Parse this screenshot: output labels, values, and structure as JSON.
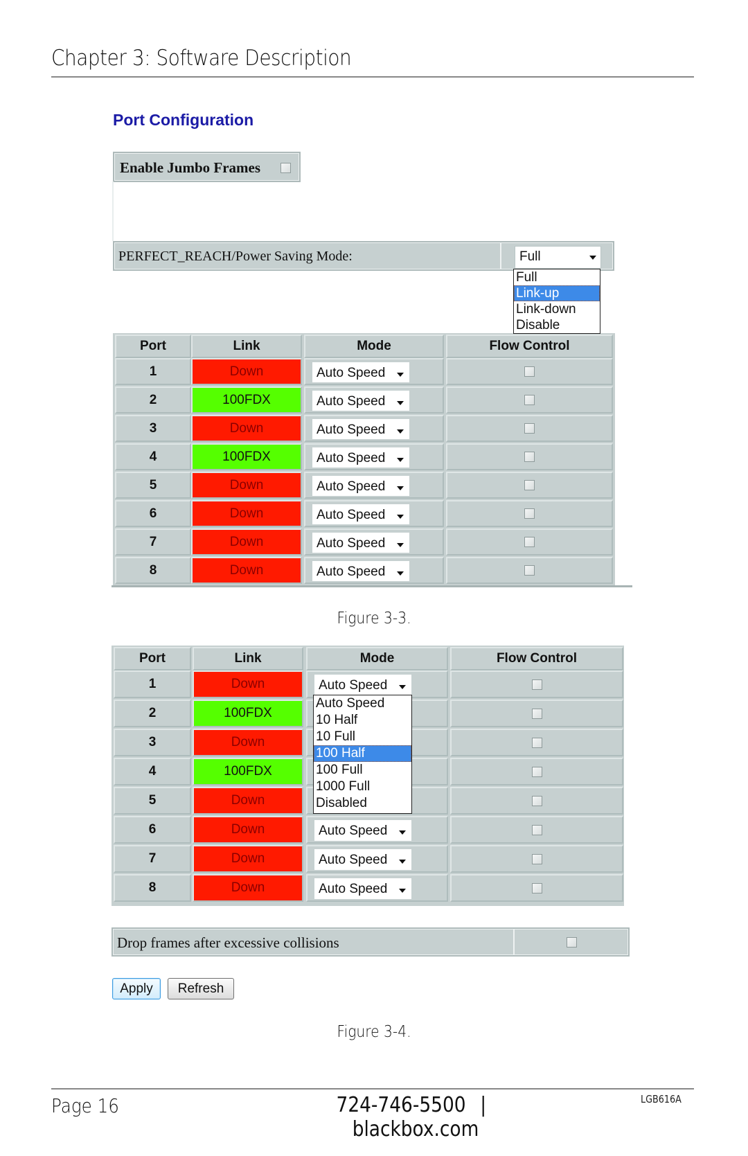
{
  "header": {
    "chapter_title": "Chapter 3: Software Description"
  },
  "port_configuration": {
    "title": "Port Configuration",
    "jumbo_frames": {
      "label": "Enable Jumbo Frames",
      "checked": false
    },
    "power_saving": {
      "label": "PERFECT_REACH/Power Saving Mode:",
      "selected": "Full",
      "options": [
        "Full",
        "Link-up",
        "Link-down",
        "Disable"
      ],
      "highlighted": "Link-up"
    }
  },
  "figure_3_3": {
    "caption": "Figure 3-3.",
    "columns": [
      "Port",
      "Link",
      "Mode",
      "Flow Control"
    ],
    "rows": [
      {
        "port": "1",
        "link": "Down",
        "link_state": "down",
        "mode": "Auto Speed",
        "flow_control": false
      },
      {
        "port": "2",
        "link": "100FDX",
        "link_state": "up",
        "mode": "Auto Speed",
        "flow_control": false
      },
      {
        "port": "3",
        "link": "Down",
        "link_state": "down",
        "mode": "Auto Speed",
        "flow_control": false
      },
      {
        "port": "4",
        "link": "100FDX",
        "link_state": "up",
        "mode": "Auto Speed",
        "flow_control": false
      },
      {
        "port": "5",
        "link": "Down",
        "link_state": "down",
        "mode": "Auto Speed",
        "flow_control": false
      },
      {
        "port": "6",
        "link": "Down",
        "link_state": "down",
        "mode": "Auto Speed",
        "flow_control": false
      },
      {
        "port": "7",
        "link": "Down",
        "link_state": "down",
        "mode": "Auto Speed",
        "flow_control": false
      },
      {
        "port": "8",
        "link": "Down",
        "link_state": "down",
        "mode": "Auto Speed",
        "flow_control": false
      }
    ]
  },
  "figure_3_4": {
    "caption": "Figure 3-4.",
    "columns": [
      "Port",
      "Link",
      "Mode",
      "Flow Control"
    ],
    "rows": [
      {
        "port": "1",
        "link": "Down",
        "link_state": "down",
        "mode": "Auto Speed",
        "flow_control": false
      },
      {
        "port": "2",
        "link": "100FDX",
        "link_state": "up",
        "mode": "",
        "flow_control": false
      },
      {
        "port": "3",
        "link": "Down",
        "link_state": "down",
        "mode": "",
        "flow_control": false
      },
      {
        "port": "4",
        "link": "100FDX",
        "link_state": "up",
        "mode": "",
        "flow_control": false
      },
      {
        "port": "5",
        "link": "Down",
        "link_state": "down",
        "mode": "",
        "flow_control": false
      },
      {
        "port": "6",
        "link": "Down",
        "link_state": "down",
        "mode": "Auto Speed",
        "flow_control": false
      },
      {
        "port": "7",
        "link": "Down",
        "link_state": "down",
        "mode": "Auto Speed",
        "flow_control": false
      },
      {
        "port": "8",
        "link": "Down",
        "link_state": "down",
        "mode": "Auto Speed",
        "flow_control": false
      }
    ],
    "mode_dropdown": {
      "options": [
        "Auto Speed",
        "10 Half",
        "10 Full",
        "100 Half",
        "100 Full",
        "1000 Full",
        "Disabled"
      ],
      "highlighted": "100 Half"
    },
    "drop_frames": {
      "label": "Drop frames after excessive collisions",
      "checked": false
    },
    "buttons": {
      "apply": "Apply",
      "refresh": "Refresh"
    }
  },
  "footer": {
    "page": "Page 16",
    "phone": "724-746-5500",
    "separator": "|",
    "website": "blackbox.com",
    "doc_code": "LGB616A"
  },
  "colors": {
    "title_blue": "#1b1ba6",
    "panel_gray": "#c6d0d0",
    "link_down": "#ff1a00",
    "link_up": "#55ff00",
    "highlight": "#3d8ae8"
  }
}
